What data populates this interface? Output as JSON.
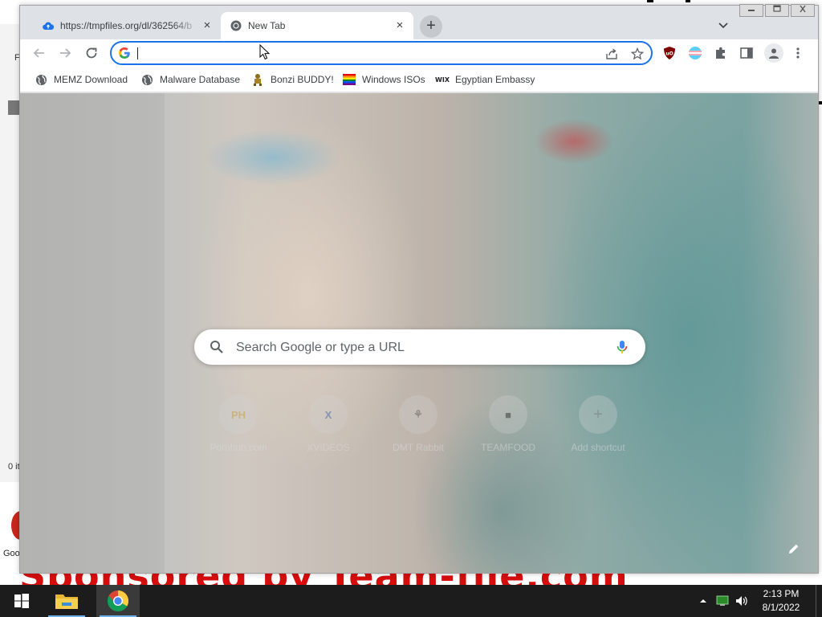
{
  "browser": {
    "tabs": [
      {
        "title": "https://tmpfiles.org/dl/362564/b",
        "favicon": "cloud-upload-icon",
        "close": "×"
      },
      {
        "title": "New Tab",
        "favicon": "chrome-icon",
        "close": "×"
      }
    ],
    "new_tab": "+",
    "omnibox": {
      "value": "",
      "placeholder": ""
    },
    "bookmarks": [
      {
        "label": "MEMZ Download",
        "icon": "globe-icon"
      },
      {
        "label": "Malware Database",
        "icon": "globe-icon"
      },
      {
        "label": "Bonzi BUDDY!",
        "icon": "bonzi-icon"
      },
      {
        "label": "Windows ISOs",
        "icon": "rainbow-flag-icon"
      },
      {
        "label": "Egyptian Embassy",
        "icon": "wix-icon"
      }
    ],
    "bookmark_wix_glyph": "WIX",
    "ublock_glyph": "uO"
  },
  "ntp": {
    "search_placeholder": "Search Google or type a URL",
    "shortcuts": [
      {
        "glyph": "PH",
        "label": "Pornhub.com",
        "color": "#c9a24a"
      },
      {
        "glyph": "X",
        "label": "XVIDEOS",
        "color": "#4a6ab0"
      },
      {
        "glyph": "⚘",
        "label": "DMT Rabbit",
        "color": "#666"
      },
      {
        "glyph": "■",
        "label": "TEAMFOOD",
        "color": "#444"
      },
      {
        "glyph": "+",
        "label": "Add shortcut",
        "color": "#888"
      }
    ]
  },
  "desktop": {
    "bg_window_text": "F",
    "bg_window_count": "0 it",
    "icon_label": "Goo",
    "red_banner": "Sponsored by Team-file.com"
  },
  "taskbar": {
    "time": "2:13 PM",
    "date": "8/1/2022"
  },
  "colors": {
    "accent": "#1a73e8",
    "taskbar": "#1c1c1c",
    "banner_red": "#d50d0d"
  }
}
